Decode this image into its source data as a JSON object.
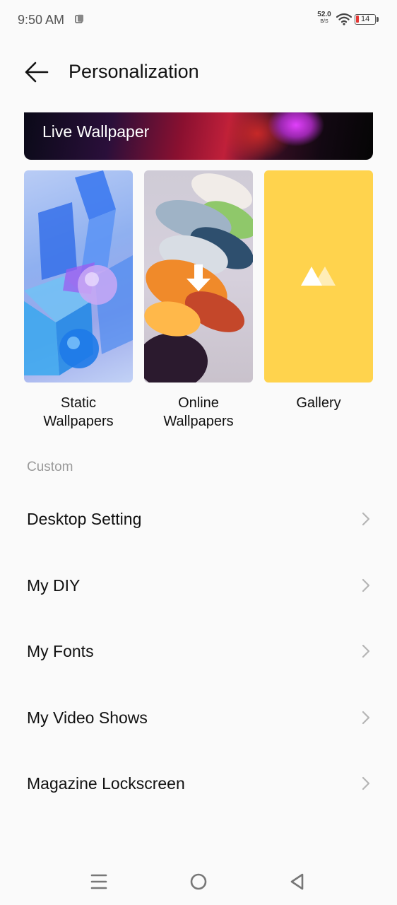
{
  "status_bar": {
    "time": "9:50 AM",
    "net_speed_value": "52.0",
    "net_speed_unit": "B/S",
    "battery_level": "14",
    "battery_color": "#e53935"
  },
  "header": {
    "back_icon": "arrow-left-icon",
    "title": "Personalization"
  },
  "live_wallpaper": {
    "label": "Live Wallpaper"
  },
  "wallpaper_tiles": [
    {
      "label_line1": "Static",
      "label_line2": "Wallpapers"
    },
    {
      "label_line1": "Online",
      "label_line2": "Wallpapers",
      "icon": "download-arrow-icon"
    },
    {
      "label_line1": "Gallery",
      "label_line2": "",
      "icon": "mountain-image-icon",
      "color": "#ffd34d"
    }
  ],
  "custom_section": {
    "header": "Custom",
    "items": [
      {
        "label": "Desktop Setting"
      },
      {
        "label": "My DIY"
      },
      {
        "label": "My Fonts"
      },
      {
        "label": "My Video Shows"
      },
      {
        "label": "Magazine Lockscreen"
      }
    ],
    "item_icon": "chevron-right-icon"
  },
  "nav_bar": {
    "buttons": [
      "menu-icon",
      "home-circle-icon",
      "back-triangle-icon"
    ]
  }
}
